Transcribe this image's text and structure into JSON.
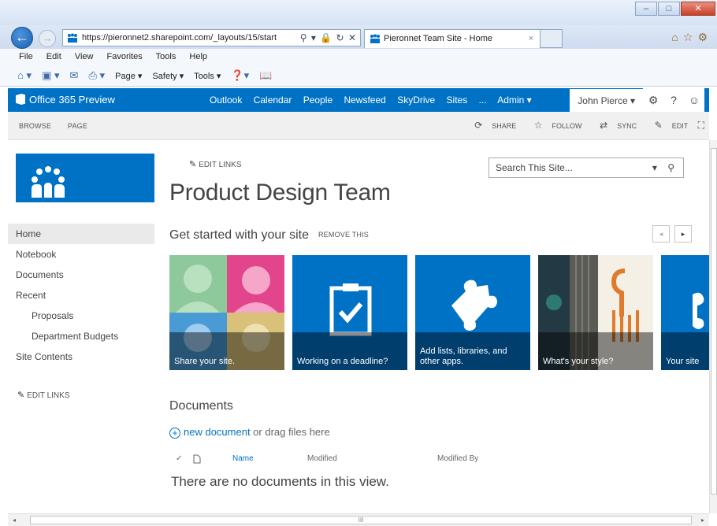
{
  "browser": {
    "url": "https://pieronnet2.sharepoint.com/_layouts/15/start",
    "tab_title": "Pieronnet Team Site - Home",
    "tab_close": "×",
    "back_glyph": "←",
    "forward_glyph": "→",
    "addr_tools": "⚲ ▾ 🔒 ↻ ✕",
    "window_controls": {
      "minimize": "–",
      "maximize": "□",
      "close": "✕"
    },
    "menu": [
      "File",
      "Edit",
      "View",
      "Favorites",
      "Tools",
      "Help"
    ],
    "commands": [
      "Page ▾",
      "Safety ▾",
      "Tools ▾"
    ],
    "chrome_icon_names": [
      "home-icon",
      "favorites-star-icon",
      "settings-gear-icon"
    ]
  },
  "suite": {
    "brand": "Office 365 Preview",
    "links": [
      "Outlook",
      "Calendar",
      "People",
      "Newsfeed",
      "SkyDrive",
      "Sites",
      "...",
      "Admin ▾"
    ],
    "user": "John Pierce ▾",
    "icons": {
      "settings": "⚙",
      "help": "?",
      "profile": "☺"
    },
    "accent_color": "#0072c6"
  },
  "ribbon": {
    "tabs": [
      "BROWSE",
      "PAGE"
    ],
    "actions": [
      {
        "label": "SHARE",
        "icon": "share-icon"
      },
      {
        "label": "FOLLOW",
        "icon": "star-icon"
      },
      {
        "label": "SYNC",
        "icon": "sync-icon"
      },
      {
        "label": "EDIT",
        "icon": "pencil-icon"
      }
    ]
  },
  "site": {
    "edit_links": "EDIT LINKS",
    "title": "Product Design Team",
    "search_placeholder": "Search This Site...",
    "search_tools": "▾ ⚲"
  },
  "nav": {
    "items": [
      {
        "label": "Home"
      },
      {
        "label": "Notebook"
      },
      {
        "label": "Documents"
      },
      {
        "label": "Recent"
      },
      {
        "label": "Proposals"
      },
      {
        "label": "Department Budgets"
      },
      {
        "label": "Site Contents"
      }
    ],
    "edit_links": "EDIT LINKS"
  },
  "getting_started": {
    "title": "Get started with your site",
    "remove": "REMOVE THIS",
    "prev": "◂",
    "next": "▸",
    "tiles": [
      {
        "caption": "Share your site."
      },
      {
        "caption": "Working on a deadline?"
      },
      {
        "caption": "Add lists, libraries, and other apps."
      },
      {
        "caption": "What's your style?"
      },
      {
        "caption": "Your site"
      }
    ]
  },
  "documents": {
    "title": "Documents",
    "new_document": "new document",
    "drag_text": " or drag files here",
    "columns": [
      "Name",
      "Modified",
      "Modified By"
    ],
    "empty_message": "There are no documents in this view."
  },
  "scrollbar": {
    "grip": "III"
  }
}
